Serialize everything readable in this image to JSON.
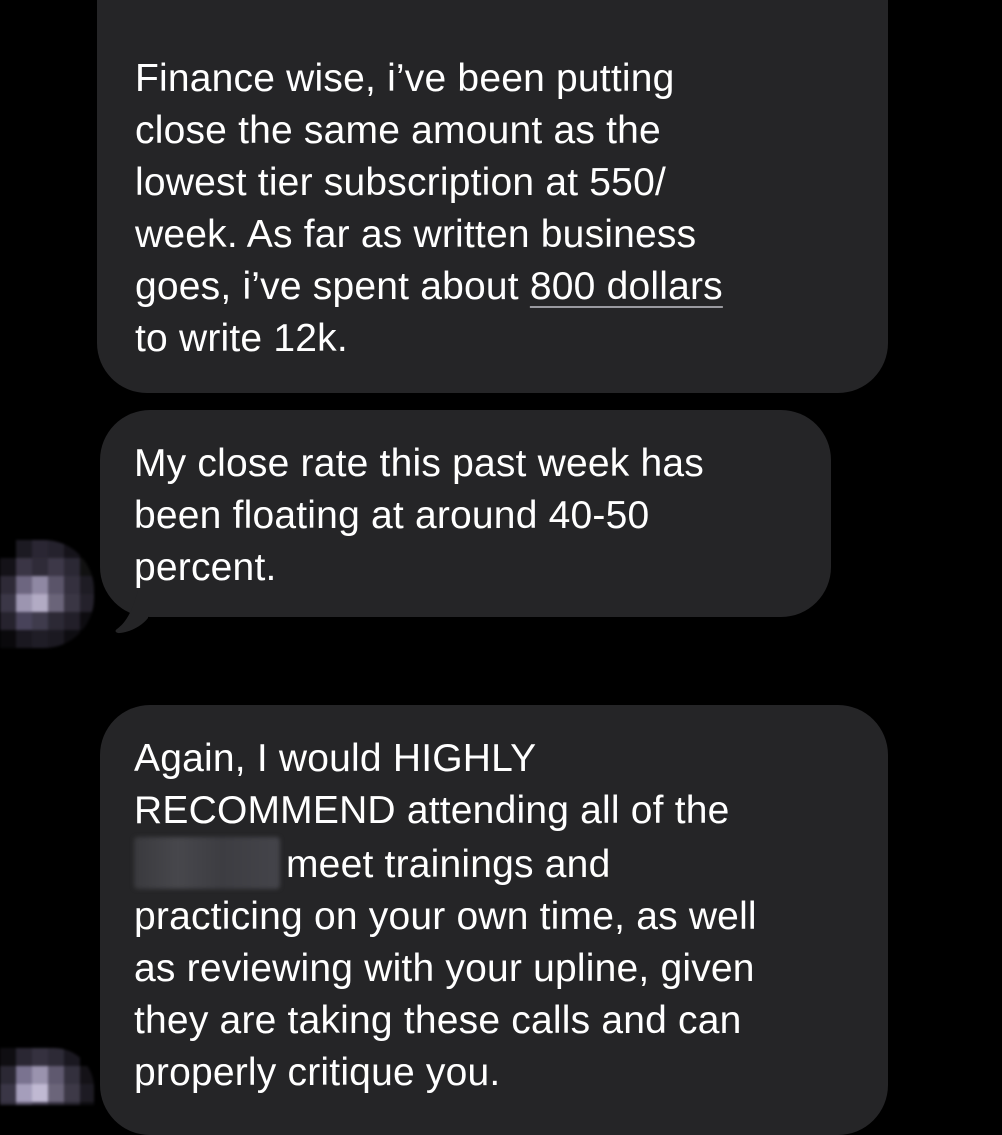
{
  "messages": [
    {
      "lines": [
        {
          "text": "Finance wise, i’ve been putting"
        },
        {
          "text": "close the same amount as the"
        },
        {
          "text": "lowest tier subscription at 550/"
        },
        {
          "text": "week. As far as written business"
        },
        {
          "pre": "goes, i’ve spent about ",
          "link": "800 dollars"
        },
        {
          "text": "to write 12k."
        }
      ]
    },
    {
      "lines": [
        {
          "text": "My close rate this past week has"
        },
        {
          "text": "been floating at around 40-50"
        },
        {
          "text": "percent."
        }
      ]
    },
    {
      "lines": [
        {
          "text": "Again, I would HIGHLY"
        },
        {
          "text": "RECOMMEND attending all of the"
        },
        {
          "after_redaction": "meet trainings and"
        },
        {
          "text": "practicing on your own time, as well"
        },
        {
          "text": "as reviewing with your upline, given"
        },
        {
          "text": "they are taking these calls and can"
        },
        {
          "text": "properly critique you."
        }
      ]
    }
  ],
  "colors": {
    "background": "#000000",
    "bubble": "#252527",
    "text": "#ffffff"
  }
}
